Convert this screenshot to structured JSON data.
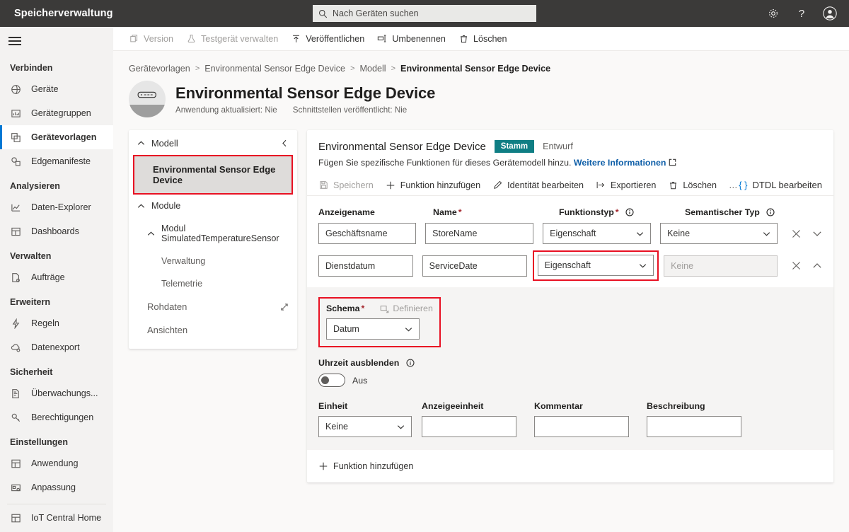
{
  "topbar": {
    "brand": "Speicherverwaltung",
    "search_placeholder": "Nach Geräten suchen",
    "icons": {
      "settings": "gear-icon",
      "help": "question-icon",
      "account": "account-icon"
    }
  },
  "nav": {
    "groups": [
      {
        "label": "Verbinden",
        "items": [
          {
            "label": "Geräte",
            "icon": "devices-icon",
            "selected": false
          },
          {
            "label": "Gerätegruppen",
            "icon": "device-groups-icon",
            "selected": false
          },
          {
            "label": "Gerätevorlagen",
            "icon": "device-templates-icon",
            "selected": true
          },
          {
            "label": "Edgemanifeste",
            "icon": "edge-manifests-icon",
            "selected": false
          }
        ]
      },
      {
        "label": "Analysieren",
        "items": [
          {
            "label": "Daten-Explorer",
            "icon": "chart-line-icon",
            "selected": false
          },
          {
            "label": "Dashboards",
            "icon": "dashboard-icon",
            "selected": false
          }
        ]
      },
      {
        "label": "Verwalten",
        "items": [
          {
            "label": "Aufträge",
            "icon": "jobs-icon",
            "selected": false
          }
        ]
      },
      {
        "label": "Erweitern",
        "items": [
          {
            "label": "Regeln",
            "icon": "rules-icon",
            "selected": false
          },
          {
            "label": "Datenexport",
            "icon": "data-export-icon",
            "selected": false
          }
        ]
      },
      {
        "label": "Sicherheit",
        "items": [
          {
            "label": "Überwachungs...",
            "icon": "audit-log-icon",
            "selected": false
          },
          {
            "label": "Berechtigungen",
            "icon": "permissions-key-icon",
            "selected": false
          }
        ]
      },
      {
        "label": "Einstellungen",
        "items": [
          {
            "label": "Anwendung",
            "icon": "application-icon",
            "selected": false
          },
          {
            "label": "Anpassung",
            "icon": "customization-icon",
            "selected": false
          }
        ]
      }
    ],
    "footer_item": {
      "label": "IoT Central Home",
      "icon": "home-grid-icon"
    }
  },
  "command_bar": [
    {
      "label": "Version",
      "icon": "copy-icon",
      "disabled": true
    },
    {
      "label": "Testgerät verwalten",
      "icon": "flask-icon",
      "disabled": true
    },
    {
      "label": "Veröffentlichen",
      "icon": "publish-up-arrow-icon",
      "disabled": false
    },
    {
      "label": "Umbenennen",
      "icon": "rename-icon",
      "disabled": false
    },
    {
      "label": "Löschen",
      "icon": "trash-icon",
      "disabled": false
    }
  ],
  "breadcrumb": {
    "items": [
      "Gerätevorlagen",
      "Environmental Sensor Edge Device",
      "Modell"
    ],
    "current": "Environmental Sensor Edge Device"
  },
  "page_header": {
    "title": "Environmental Sensor Edge Device",
    "meta_app_updated": "Anwendung aktualisiert: Nie",
    "meta_interfaces_published": "Schnittstellen veröffentlicht: Nie"
  },
  "tree": {
    "model_header": "Modell",
    "selected_model": "Environmental Sensor Edge Device",
    "modules_header": "Module",
    "module_name": "Modul SimulatedTemperatureSensor",
    "module_children": [
      "Verwaltung",
      "Telemetrie"
    ],
    "raw_data": "Rohdaten",
    "views": "Ansichten"
  },
  "main": {
    "title": "Environmental Sensor Edge Device",
    "badge": "Stamm",
    "draft_tab": "Entwurf",
    "description": "Fügen Sie spezifische Funktionen für dieses Gerätemodell hinzu.",
    "description_link": "Weitere Informationen",
    "commands": [
      {
        "label": "Speichern",
        "icon": "save-icon",
        "disabled": true
      },
      {
        "label": "Funktion hinzufügen",
        "icon": "plus-icon",
        "disabled": false
      },
      {
        "label": "Identität bearbeiten",
        "icon": "pencil-icon",
        "disabled": false
      },
      {
        "label": "Exportieren",
        "icon": "export-icon",
        "disabled": false
      },
      {
        "label": "Löschen",
        "icon": "trash-icon",
        "disabled": false
      },
      {
        "label": "…",
        "icon": "ellipsis-icon",
        "disabled": false
      }
    ],
    "dtdl_button": "DTDL bearbeiten",
    "columns": {
      "display_name": "Anzeigename",
      "name": "Name",
      "capability_type": "Funktionstyp",
      "semantic_type": "Semantischer Typ"
    },
    "rows": [
      {
        "display_name": "Geschäftsname",
        "name": "StoreName",
        "capability_type": "Eigenschaft",
        "semantic_type": "Keine",
        "semantic_disabled": false,
        "expanded": false,
        "chevron": "chevron-down-icon"
      },
      {
        "display_name": "Dienstdatum",
        "name": "ServiceDate",
        "capability_type": "Eigenschaft",
        "semantic_type": "Keine",
        "semantic_disabled": true,
        "expanded": true,
        "chevron": "chevron-up-icon"
      }
    ],
    "detail": {
      "schema_label": "Schema",
      "define_label": "Definieren",
      "schema_value": "Datum",
      "hide_time_label": "Uhrzeit ausblenden",
      "toggle_state": "Aus",
      "unit_label": "Einheit",
      "unit_value": "Keine",
      "display_unit_label": "Anzeigeeinheit",
      "display_unit_value": "",
      "comment_label": "Kommentar",
      "comment_value": "",
      "description_label": "Beschreibung",
      "description_value": ""
    },
    "add_capability": "Funktion hinzufügen"
  },
  "colors": {
    "topbar_bg": "#3b3a39",
    "nav_bg": "#f3f2f1",
    "accent_blue": "#0078d4",
    "badge_teal": "#0f7e84",
    "highlight_red": "#e81123",
    "link_blue": "#0f5fa8"
  }
}
